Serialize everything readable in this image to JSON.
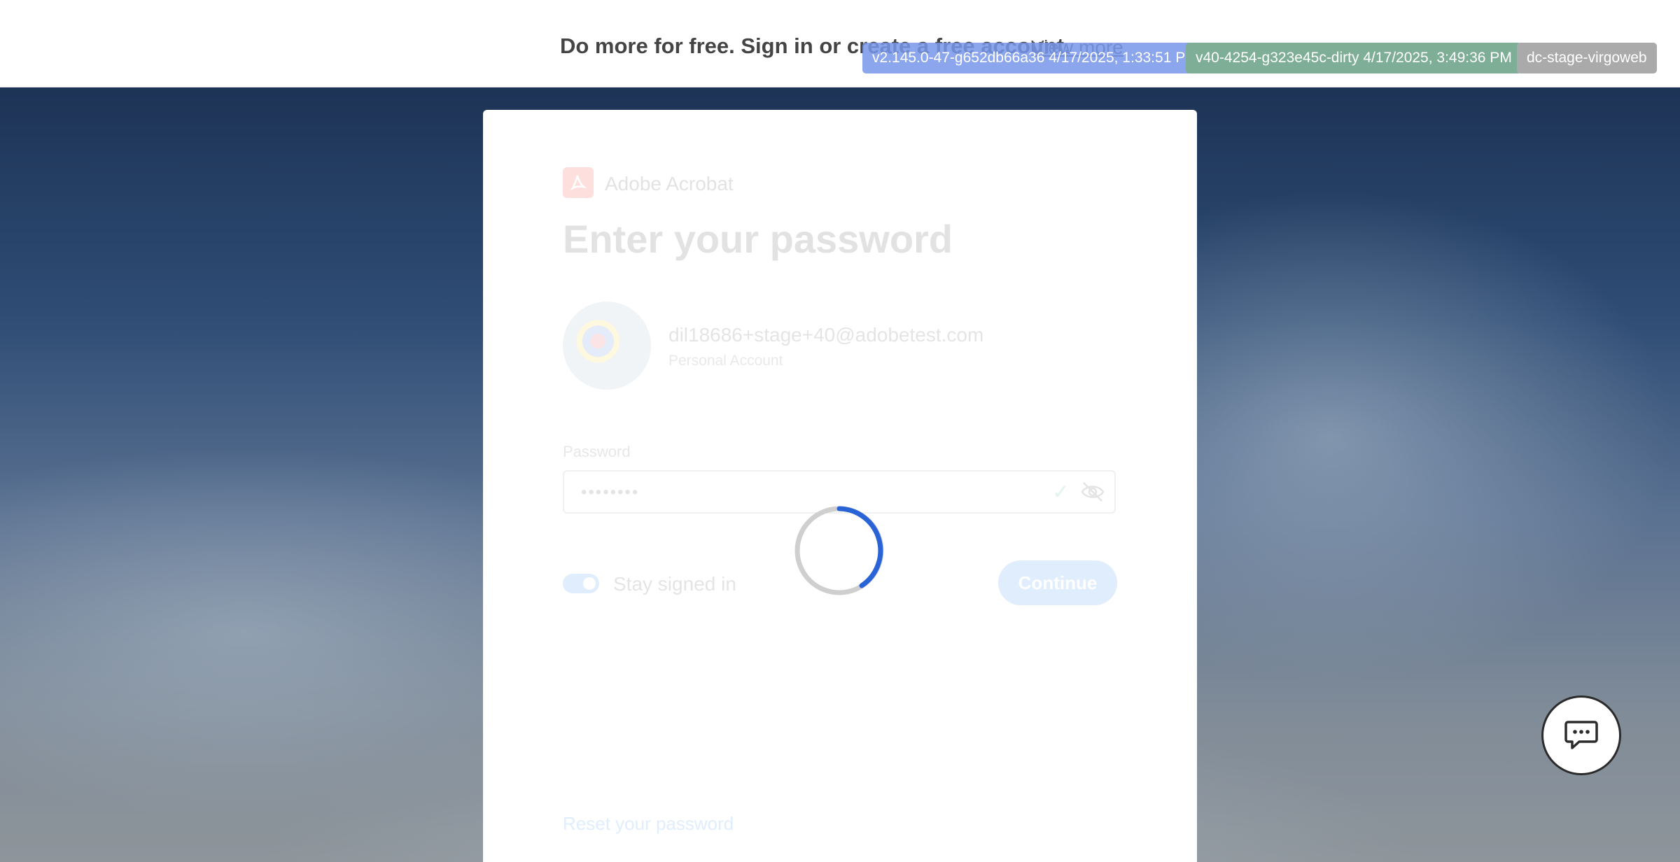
{
  "banner": {
    "promo_text": "Do more for free. Sign in or create a free account.",
    "link_text": "View more"
  },
  "badges": [
    {
      "text": "v2.145.0-47-g652db66a36 4/17/2025, 1:33:51 PM",
      "color": "#7896eb"
    },
    {
      "text": "v40-4254-g323e45c-dirty 4/17/2025, 3:49:36 PM",
      "color": "#7fae96"
    },
    {
      "text": "dc-stage-virgoweb",
      "color": "#aaaaaa"
    }
  ],
  "card": {
    "app_name": "Adobe Acrobat",
    "heading": "Enter your password",
    "account": {
      "email": "dil18686+stage+40@adobetest.com",
      "type": "Personal Account"
    },
    "password": {
      "label": "Password",
      "masked_value": "••••••••"
    },
    "stay_signed_in": {
      "label": "Stay signed in",
      "checked": true
    },
    "continue_label": "Continue",
    "reset_link": "Reset your password"
  },
  "spinner": {
    "state": "loading",
    "accent": "#2a63d6"
  },
  "chat": {
    "icon": "chat-bubble-icon"
  }
}
